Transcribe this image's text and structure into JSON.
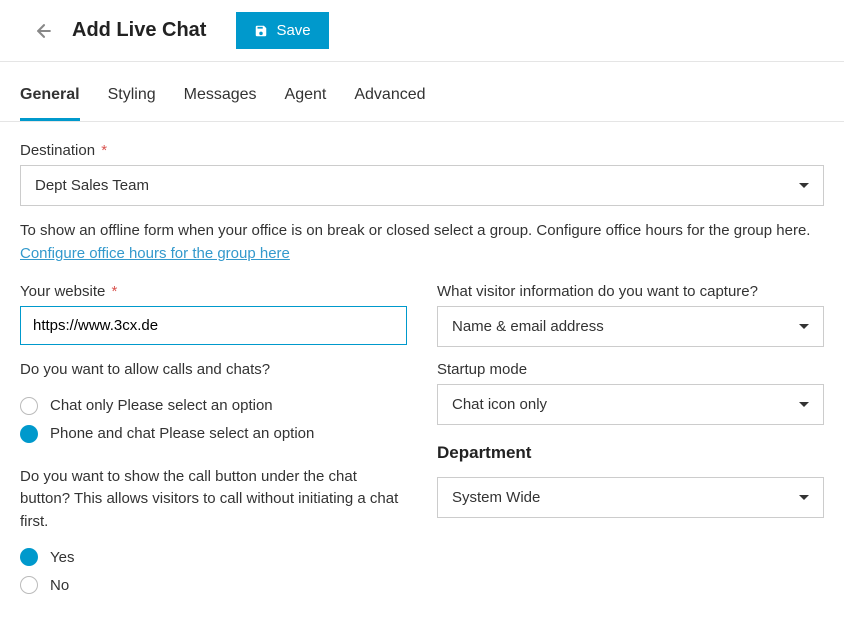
{
  "header": {
    "title": "Add Live Chat",
    "save_label": "Save"
  },
  "tabs": [
    {
      "label": "General",
      "active": true
    },
    {
      "label": "Styling",
      "active": false
    },
    {
      "label": "Messages",
      "active": false
    },
    {
      "label": "Agent",
      "active": false
    },
    {
      "label": "Advanced",
      "active": false
    }
  ],
  "destination": {
    "label": "Destination",
    "value": "Dept Sales Team"
  },
  "helper": {
    "text": "To show an offline form when your office is on break or closed select a group. Configure office hours for the group here. ",
    "link": "Configure office hours for the group here"
  },
  "website": {
    "label": "Your website",
    "value": "https://www.3cx.de"
  },
  "allow_calls": {
    "question": "Do you want to allow calls and chats?",
    "opt1": "Chat only Please select an option",
    "opt2": "Phone and chat Please select an option"
  },
  "call_button": {
    "question": "Do you want to show the call button under the chat button? This allows visitors to call without initiating a chat first.",
    "yes": "Yes",
    "no": "No"
  },
  "capture": {
    "label": "What visitor information do you want to capture?",
    "value": "Name & email address"
  },
  "startup": {
    "label": "Startup mode",
    "value": "Chat icon only"
  },
  "department": {
    "heading": "Department",
    "value": "System Wide"
  }
}
